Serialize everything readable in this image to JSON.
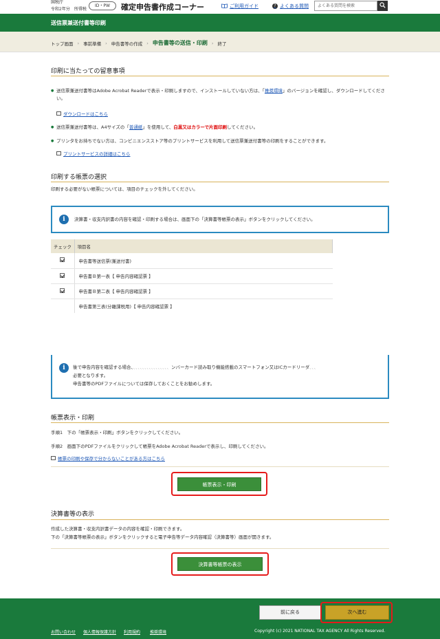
{
  "header": {
    "agency": "国税庁",
    "year": "令和2年分　所得税",
    "idpw": "ID・PW",
    "title": "確定申告書作成コーナー",
    "guide_link": "ご利用ガイド",
    "faq_link": "よくある質問",
    "search_placeholder": "よくある質問を検索"
  },
  "page_title": "送信票兼送付書等印刷",
  "breadcrumb": {
    "items": [
      "トップ画面",
      "事前準備",
      "申告書等の作成",
      "申告書等の送信・印刷",
      "終了"
    ]
  },
  "notes": {
    "title": "印刷に当たっての留意事項",
    "b1_a": "送信票兼送付書等はAdobe Acrobat Readerで表示・印刷しますので、インストールしていない方は、「",
    "b1_link": "推奨環境",
    "b1_b": "」のバージョンを確認し、ダウンロードしてください。",
    "download_link": "ダウンロードはこちら",
    "b2_a": "送信票兼送付書等は、A4サイズの「",
    "b2_link": "普通紙",
    "b2_b": "」を使用して、",
    "b2_red": "白黒又はカラーで片面印刷",
    "b2_c": "してください。",
    "b3": "プリンタをお持ちでない方は、コンビニエンスストア等のプリントサービスを利用して送信票兼送付書等の印刷をすることができます。",
    "print_service_link": "プリントサービスの詳細はこちら"
  },
  "select": {
    "title": "印刷する帳票の選択",
    "desc": "印刷する必要がない帳票については、項目のチェックを外してください。",
    "info": "決算書・収支内訳書の内容を確認・印刷する場合は、画面下の「決算書等帳票の表示」ボタンをクリックしてください。",
    "col_check": "チェック",
    "col_item": "項目名",
    "rows": [
      "申告書等送信票(兼送付書)",
      "申告書Ｂ第一表【 申告内容確認票 】",
      "申告書Ｂ第二表【 申告内容確認票 】",
      "申告書第三表(分離課税用)【 申告内容確認票 】"
    ]
  },
  "info2": {
    "l1a": "後で申告内容を確認する場合、",
    "l1b": "ンバーカード読み取り機能搭載のスマートフォン又はICカードリーダ",
    "l2": "必要となります。",
    "l3": "申告書等のPDFファイルについては保存しておくことをお勧めします。"
  },
  "print": {
    "title": "帳票表示・印刷",
    "step1": "手順1　下の「帳票表示・印刷」ボタンをクリックしてください。",
    "step2": "手順2　画面下のPDFファイルをクリックして帳票をAdobe Acrobat Readerで表示し、印刷してください。",
    "help_link": "帳票の印刷や保存で分からないことがある方はこちら",
    "button": "帳票表示・印刷"
  },
  "settlement": {
    "title": "決算書等の表示",
    "l1": "作成した決算書・収支内訳書データの内容を確認・印刷できます。",
    "l2": "下の「決算書等帳票の表示」ボタンをクリックすると電子申告等データ内容確認（決算書等）画面が開きます。",
    "button": "決算書等帳票の表示"
  },
  "nav": {
    "back": "前に戻る",
    "next": "次へ進む"
  },
  "footer": {
    "links": [
      "お問い合わせ",
      "個人情報保護方針",
      "利用規約",
      "推奨環境"
    ],
    "copyright": "Copyright (c) 2021 NATIONAL TAX AGENCY All Rights Reserved."
  }
}
